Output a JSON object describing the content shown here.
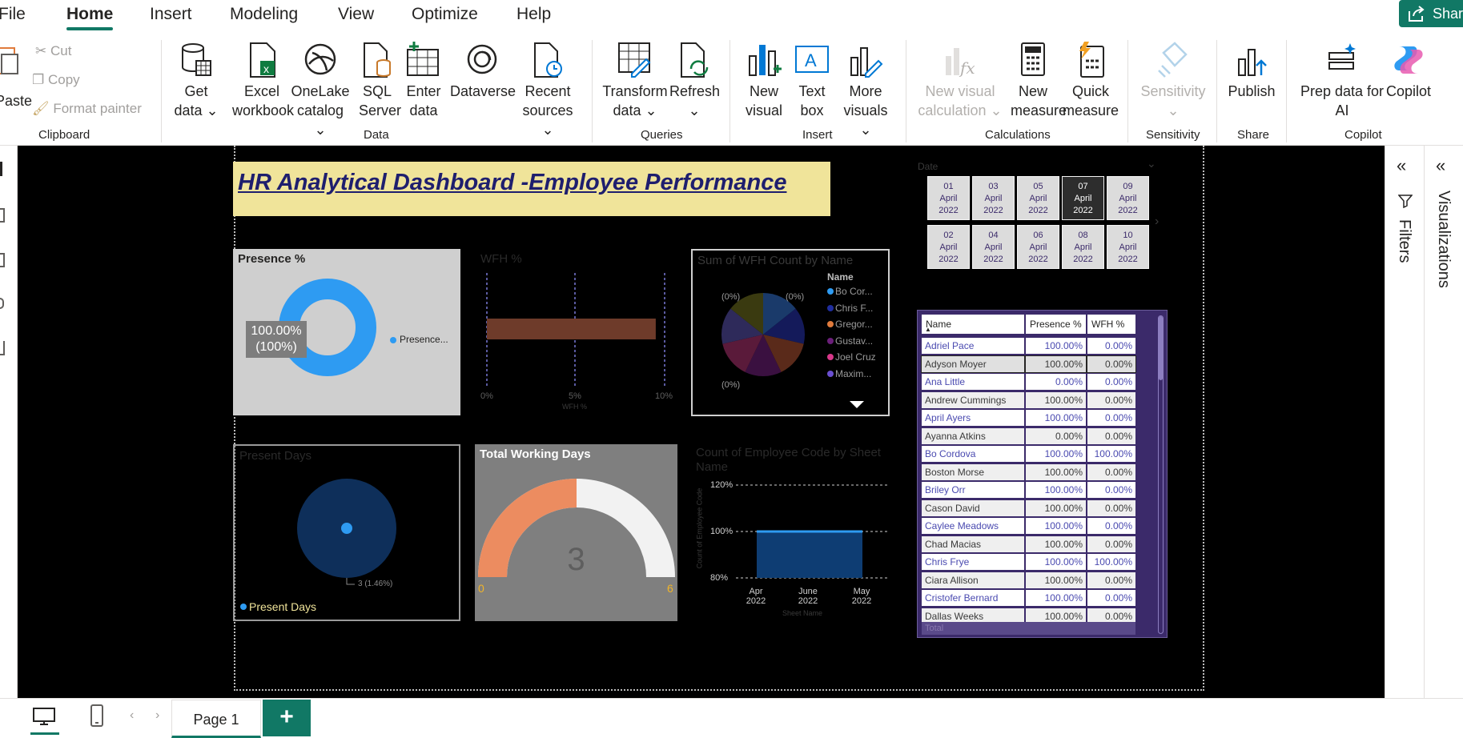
{
  "menu": {
    "tabs": [
      "File",
      "Home",
      "Insert",
      "Modeling",
      "View",
      "Optimize",
      "Help"
    ],
    "share": "Share"
  },
  "ribbon": {
    "clipboard": {
      "paste": "Paste",
      "cut": "Cut",
      "copy": "Copy",
      "format_painter": "Format painter",
      "label": "Clipboard"
    },
    "data": {
      "label": "Data",
      "buttons": [
        {
          "l1": "Get",
          "l2": "data ⌄"
        },
        {
          "l1": "Excel",
          "l2": "workbook"
        },
        {
          "l1": "OneLake",
          "l2": "catalog ⌄"
        },
        {
          "l1": "SQL",
          "l2": "Server"
        },
        {
          "l1": "Enter",
          "l2": "data"
        },
        {
          "l1": "Dataverse",
          "l2": ""
        },
        {
          "l1": "Recent",
          "l2": "sources ⌄"
        }
      ]
    },
    "queries": {
      "label": "Queries",
      "transform_l1": "Transform",
      "transform_l2": "data ⌄",
      "refresh_l1": "Refresh",
      "refresh_l2": "⌄"
    },
    "insert": {
      "label": "Insert",
      "new_visual_l1": "New",
      "new_visual_l2": "visual",
      "text_box_l1": "Text",
      "text_box_l2": "box",
      "more_visuals_l1": "More",
      "more_visuals_l2": "visuals ⌄"
    },
    "calculations": {
      "label": "Calculations",
      "new_visual_calc_l1": "New visual",
      "new_visual_calc_l2": "calculation ⌄",
      "new_measure_l1": "New",
      "new_measure_l2": "measure",
      "quick_measure_l1": "Quick",
      "quick_measure_l2": "measure"
    },
    "sensitivity": {
      "label": "Sensitivity",
      "btn": "Sensitivity",
      "chev": "⌄"
    },
    "share": {
      "label": "Share",
      "publish": "Publish"
    },
    "copilot": {
      "label": "Copilot",
      "prep_l1": "Prep data for",
      "prep_l2": "AI",
      "copilot": "Copilot"
    }
  },
  "panes": {
    "filters": "Filters",
    "visualizations": "Visualizations"
  },
  "pages": {
    "tab": "Page 1",
    "add": "+"
  },
  "dashboard": {
    "title": "HR Analytical Dashboard -Employee Performance",
    "presence": {
      "title": "Presence %",
      "center_l1": "100.00%",
      "center_l2": "(100%)",
      "legend": "Presence...",
      "value": 1.0,
      "color": "#2e9bf2"
    },
    "wfh": {
      "title": "WFH %",
      "ticks": [
        "0%",
        "5%",
        "10%"
      ],
      "axis_label": "WFH %",
      "bar_value": 0.095,
      "bar_color": "#6e3b2a"
    },
    "wfh_by_name": {
      "title": "Sum of WFH Count by Name",
      "legend_title": "Name",
      "legend": [
        {
          "name": "Bo Cor...",
          "color": "#2e9bf2"
        },
        {
          "name": "Chris F...",
          "color": "#1f2d9e"
        },
        {
          "name": "Gregor...",
          "color": "#e07b3c"
        },
        {
          "name": "Gustav...",
          "color": "#6b1f7a"
        },
        {
          "name": "Joel Cruz",
          "color": "#d8388a"
        },
        {
          "name": "Maxim...",
          "color": "#6a4fd0"
        }
      ],
      "labels": [
        "(0%)",
        "(0%)",
        "(0%)"
      ]
    },
    "present_days": {
      "title": "Present Days",
      "legend": "Present Days",
      "data_label": "3 (1.46%)"
    },
    "total_working_days": {
      "title": "Total Working Days",
      "value": "3",
      "min": "0",
      "max": "6",
      "fraction": 0.5
    },
    "emp_code_chart": {
      "title": "Count of Employee Code by Sheet Name",
      "y_ticks": [
        "120%",
        "100%",
        "80%"
      ],
      "x_ticks": [
        [
          "Apr",
          "2022"
        ],
        [
          "June",
          "2022"
        ],
        [
          "May",
          "2022"
        ]
      ],
      "y_label": "Count of Employee Code",
      "x_label": "Sheet Name"
    },
    "date_slicer": {
      "label": "Date",
      "row1": [
        [
          "01",
          "April",
          "2022"
        ],
        [
          "03",
          "April",
          "2022"
        ],
        [
          "05",
          "April",
          "2022"
        ],
        [
          "07",
          "April",
          "2022"
        ],
        [
          "09",
          "April",
          "2022"
        ]
      ],
      "row2": [
        [
          "02",
          "April",
          "2022"
        ],
        [
          "04",
          "April",
          "2022"
        ],
        [
          "06",
          "April",
          "2022"
        ],
        [
          "08",
          "April",
          "2022"
        ],
        [
          "10",
          "April",
          "2022"
        ]
      ],
      "selected": "07"
    },
    "table": {
      "headers": [
        "Name",
        "Presence %",
        "WFH %"
      ],
      "rows": [
        [
          "Adriel Pace",
          "100.00%",
          "0.00%"
        ],
        [
          "Adyson Moyer",
          "100.00%",
          "0.00%"
        ],
        [
          "Ana Little",
          "0.00%",
          "0.00%"
        ],
        [
          "Andrew Cummings",
          "100.00%",
          "0.00%"
        ],
        [
          "April Ayers",
          "100.00%",
          "0.00%"
        ],
        [
          "Ayanna Atkins",
          "0.00%",
          "0.00%"
        ],
        [
          "Bo Cordova",
          "100.00%",
          "100.00%"
        ],
        [
          "Boston Morse",
          "100.00%",
          "0.00%"
        ],
        [
          "Briley Orr",
          "100.00%",
          "0.00%"
        ],
        [
          "Cason David",
          "100.00%",
          "0.00%"
        ],
        [
          "Caylee Meadows",
          "100.00%",
          "0.00%"
        ],
        [
          "Chad Macias",
          "100.00%",
          "0.00%"
        ],
        [
          "Chris Frye",
          "100.00%",
          "100.00%"
        ],
        [
          "Ciara Allison",
          "100.00%",
          "0.00%"
        ],
        [
          "Cristofer Bernard",
          "100.00%",
          "0.00%"
        ],
        [
          "Dallas Weeks",
          "100.00%",
          "0.00%"
        ]
      ],
      "total_label": "Total"
    }
  }
}
